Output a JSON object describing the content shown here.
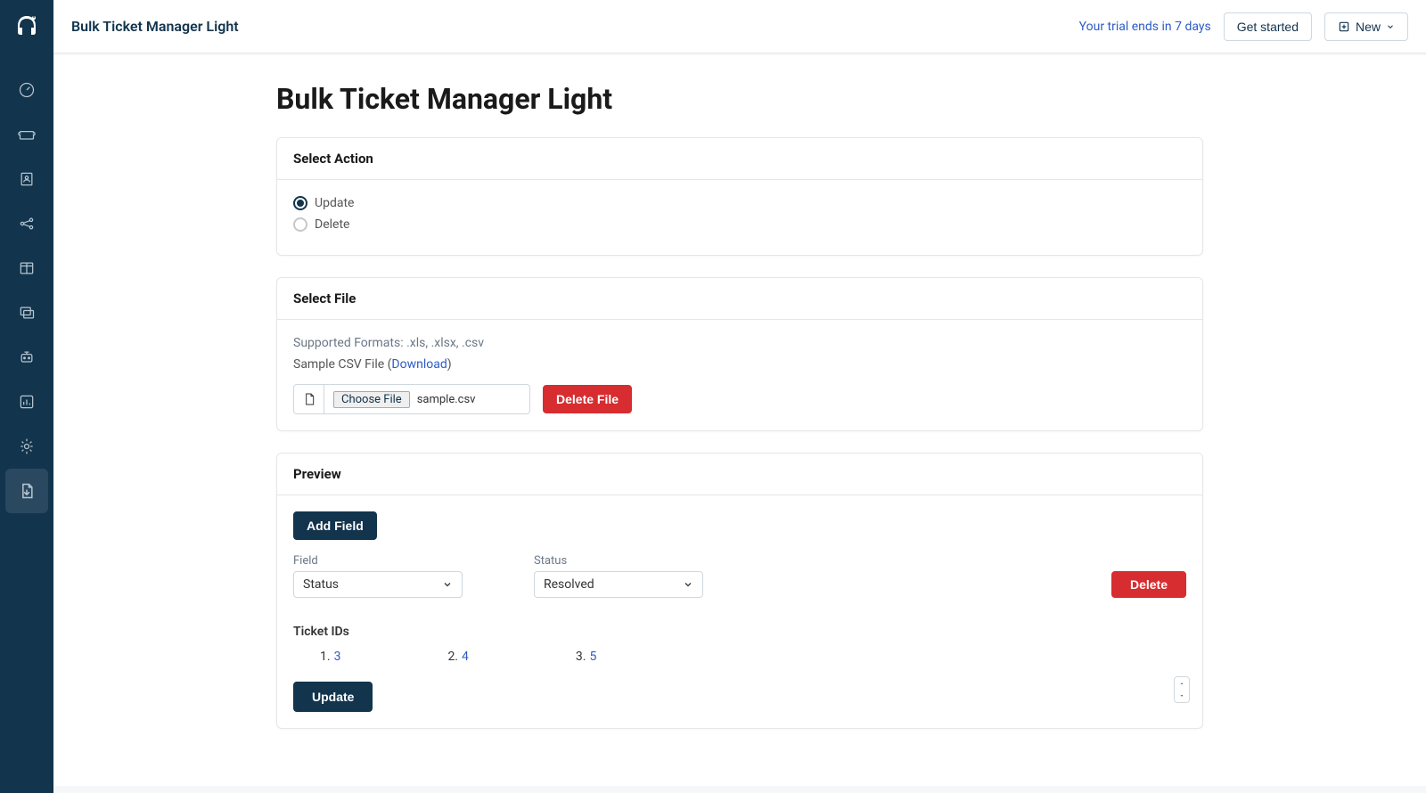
{
  "topbar": {
    "title": "Bulk Ticket Manager Light",
    "trial_text": "Your trial ends in 7 days",
    "get_started": "Get started",
    "new_label": "New"
  },
  "page": {
    "heading": "Bulk Ticket Manager Light"
  },
  "select_action": {
    "title": "Select Action",
    "options": {
      "update": "Update",
      "delete": "Delete"
    },
    "selected": "update"
  },
  "select_file": {
    "title": "Select File",
    "supported": "Supported Formats: .xls, .xlsx, .csv",
    "sample_prefix": "Sample CSV File (",
    "download": "Download",
    "sample_suffix": ")",
    "choose_file": "Choose File",
    "filename": "sample.csv",
    "delete_file": "Delete File"
  },
  "preview": {
    "title": "Preview",
    "add_field": "Add Field",
    "field_label": "Field",
    "field_value": "Status",
    "status_label": "Status",
    "status_value": "Resolved",
    "delete": "Delete",
    "ticket_ids_label": "Ticket IDs",
    "tickets": [
      {
        "ordinal": "1.",
        "id": "3"
      },
      {
        "ordinal": "2.",
        "id": "4"
      },
      {
        "ordinal": "3.",
        "id": "5"
      }
    ],
    "update": "Update"
  }
}
